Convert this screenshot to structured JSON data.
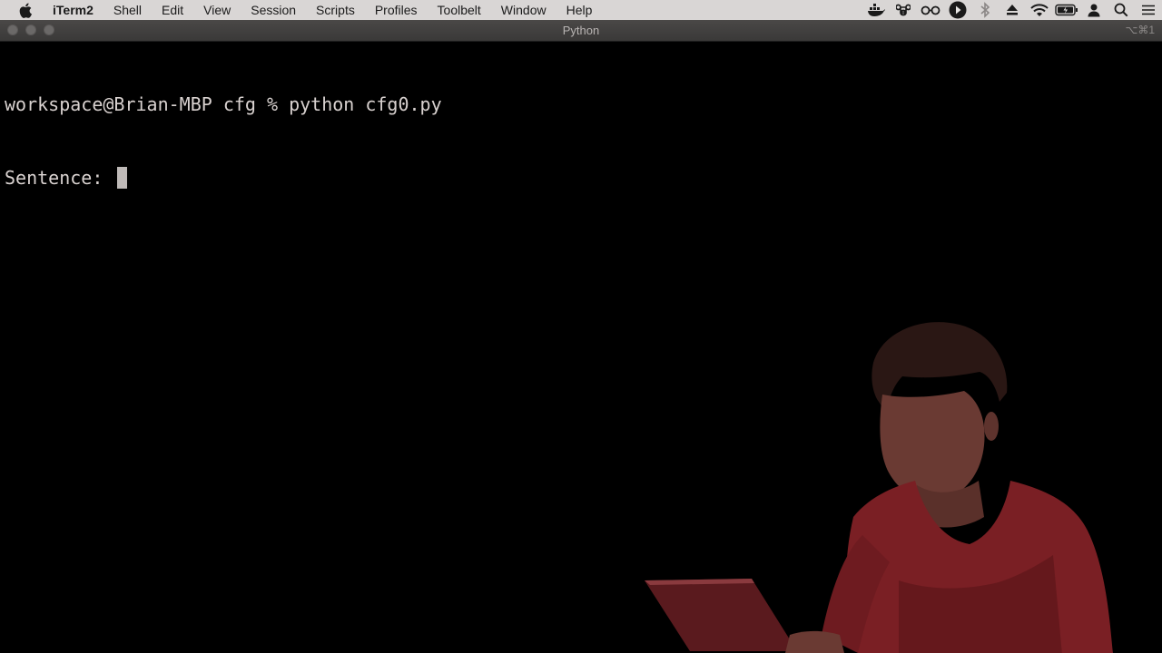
{
  "menubar": {
    "app_name": "iTerm2",
    "items": [
      "Shell",
      "Edit",
      "View",
      "Session",
      "Scripts",
      "Profiles",
      "Toolbelt",
      "Window",
      "Help"
    ],
    "status_icons": [
      "docker-icon",
      "command-key-icon",
      "glasses-icon",
      "play-icon",
      "bluetooth-icon",
      "eject-icon",
      "wifi-icon",
      "battery-charging-icon",
      "user-icon",
      "search-icon",
      "control-center-icon"
    ]
  },
  "window": {
    "title": "Python",
    "shortcut": "⌥⌘1"
  },
  "terminal": {
    "lines": [
      "workspace@Brian-MBP cfg % python cfg0.py",
      "Sentence: "
    ]
  },
  "presenter": {
    "description_icon": "presenter-photo"
  },
  "colors": {
    "menubar_bg": "#d9d6d5",
    "titlebar_bg": "#3f3e3d",
    "terminal_bg": "#000000",
    "terminal_fg": "#d9d2d0",
    "sweater": "#7a1f24"
  }
}
